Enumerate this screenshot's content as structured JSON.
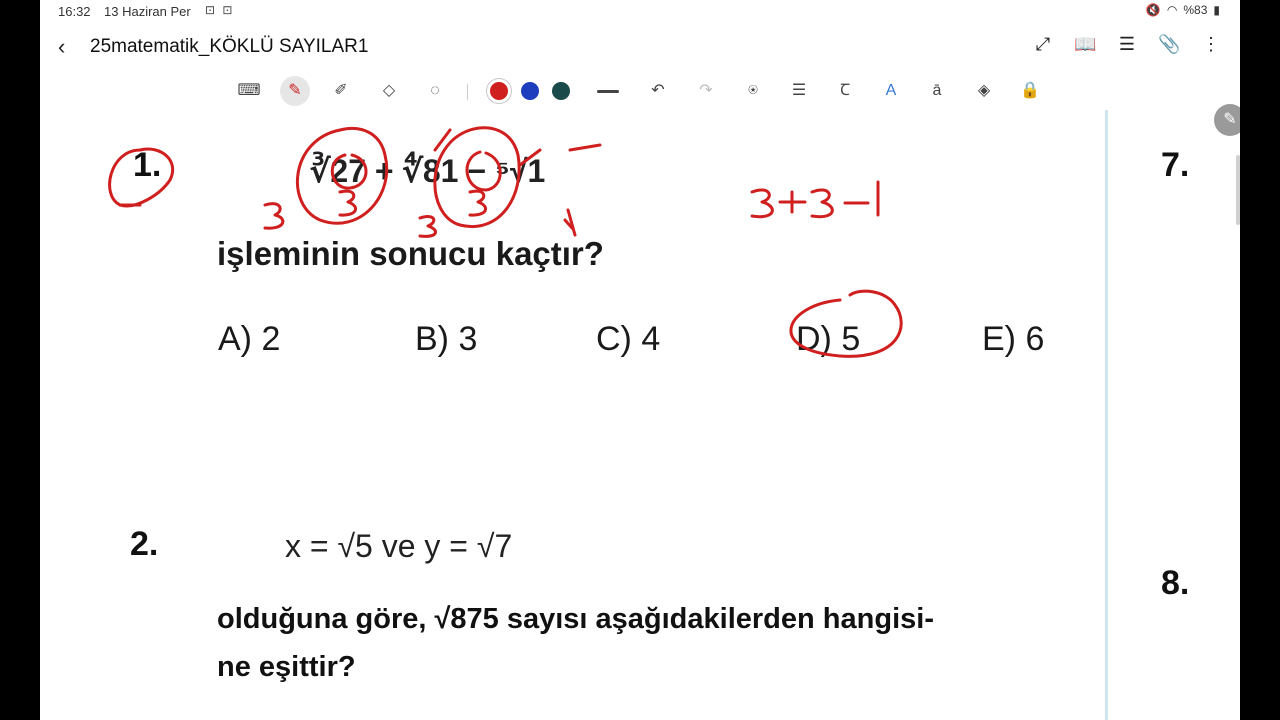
{
  "status": {
    "time": "16:32",
    "date": "13 Haziran Per",
    "left_icons": "⊡ ⊡",
    "battery": "%83"
  },
  "app": {
    "back_icon": "‹",
    "title": "25matematik_KÖKLÜ SAYILAR1",
    "actions": [
      "expand-icon",
      "book-icon",
      "list-icon",
      "attach-icon",
      "more-icon"
    ]
  },
  "toolbar": {
    "tools": [
      "keyboard-icon",
      "pen-icon",
      "highlighter-icon",
      "eraser-icon",
      "lasso-icon"
    ],
    "colors": [
      "#d01f1f",
      "#1f3ebd",
      "#1a4a4a"
    ],
    "more_tools": [
      "undo-icon",
      "redo-icon",
      "shape-text-icon",
      "align-icon",
      "text-style-icon",
      "text-color-icon",
      "text-format-icon",
      "shapes-icon",
      "lock-icon"
    ]
  },
  "question1": {
    "number": "1.",
    "expression": "∛27 + ∜81 − ⁵√1",
    "text": "işleminin sonucu kaçtır?",
    "options": [
      "A) 2",
      "B) 3",
      "C) 4",
      "D) 5",
      "E) 6"
    ]
  },
  "question2": {
    "number": "2.",
    "given": "x = √5   ve   y = √7",
    "text_line1": "olduğuna göre, √875 sayısı aşağıdakilerden hangisi-",
    "text_line2": "ne eşittir?"
  },
  "right_page": {
    "q7": "7.",
    "q8": "8."
  },
  "annotation_color": "#d01f1f",
  "annotations": {
    "sum_note": "3+3−1"
  }
}
